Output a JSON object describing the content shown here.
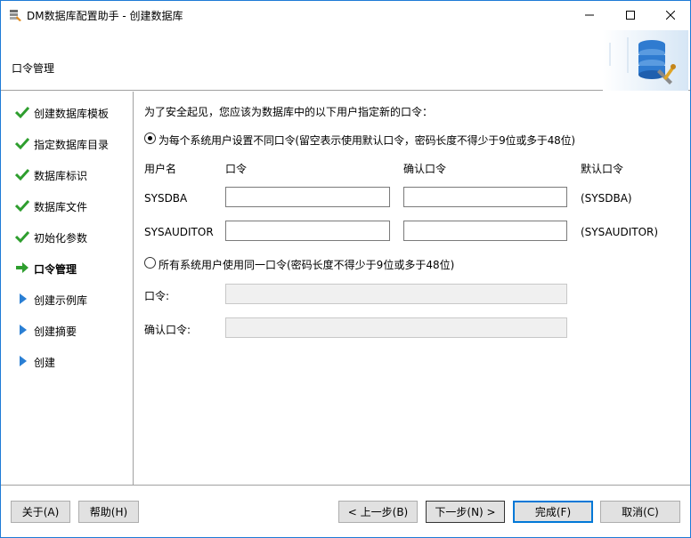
{
  "window": {
    "title": "DM数据库配置助手 - 创建数据库",
    "min_icon": "minimize-icon",
    "max_icon": "maximize-icon",
    "close_icon": "close-icon"
  },
  "header": {
    "title": "口令管理"
  },
  "nav": {
    "items": [
      {
        "label": "创建数据库模板",
        "icon": "check-icon",
        "state": "done"
      },
      {
        "label": "指定数据库目录",
        "icon": "check-icon",
        "state": "done"
      },
      {
        "label": "数据库标识",
        "icon": "check-icon",
        "state": "done"
      },
      {
        "label": "数据库文件",
        "icon": "check-icon",
        "state": "done"
      },
      {
        "label": "初始化参数",
        "icon": "check-icon",
        "state": "done"
      },
      {
        "label": "口令管理",
        "icon": "arrow-right-icon",
        "state": "active"
      },
      {
        "label": "创建示例库",
        "icon": "triangle-right-icon",
        "state": "pending"
      },
      {
        "label": "创建摘要",
        "icon": "triangle-right-icon",
        "state": "pending"
      },
      {
        "label": "创建",
        "icon": "triangle-right-icon",
        "state": "pending"
      }
    ]
  },
  "content": {
    "intro": "为了安全起见，您应该为数据库中的以下用户指定新的口令：",
    "option_separate": "为每个系统用户设置不同口令(留空表示使用默认口令，密码长度不得少于9位或多于48位)",
    "col_user": "用户名",
    "col_password": "口令",
    "col_confirm": "确认口令",
    "col_default": "默认口令",
    "rows": [
      {
        "user": "SYSDBA",
        "password": "",
        "confirm": "",
        "default": "(SYSDBA)"
      },
      {
        "user": "SYSAUDITOR",
        "password": "",
        "confirm": "",
        "default": "(SYSAUDITOR)"
      }
    ],
    "option_same": "所有系统用户使用同一口令(密码长度不得少于9位或多于48位)",
    "same_password_label": "口令:",
    "same_confirm_label": "确认口令:",
    "same_password_value": "",
    "same_confirm_value": ""
  },
  "footer": {
    "about": "关于(A)",
    "help": "帮助(H)",
    "back": "< 上一步(B)",
    "next": "下一步(N) >",
    "finish": "完成(F)",
    "cancel": "取消(C)"
  },
  "colors": {
    "accent": "#0078d7",
    "check_green": "#2e9e2e",
    "arrow_blue": "#2a7fd4"
  }
}
